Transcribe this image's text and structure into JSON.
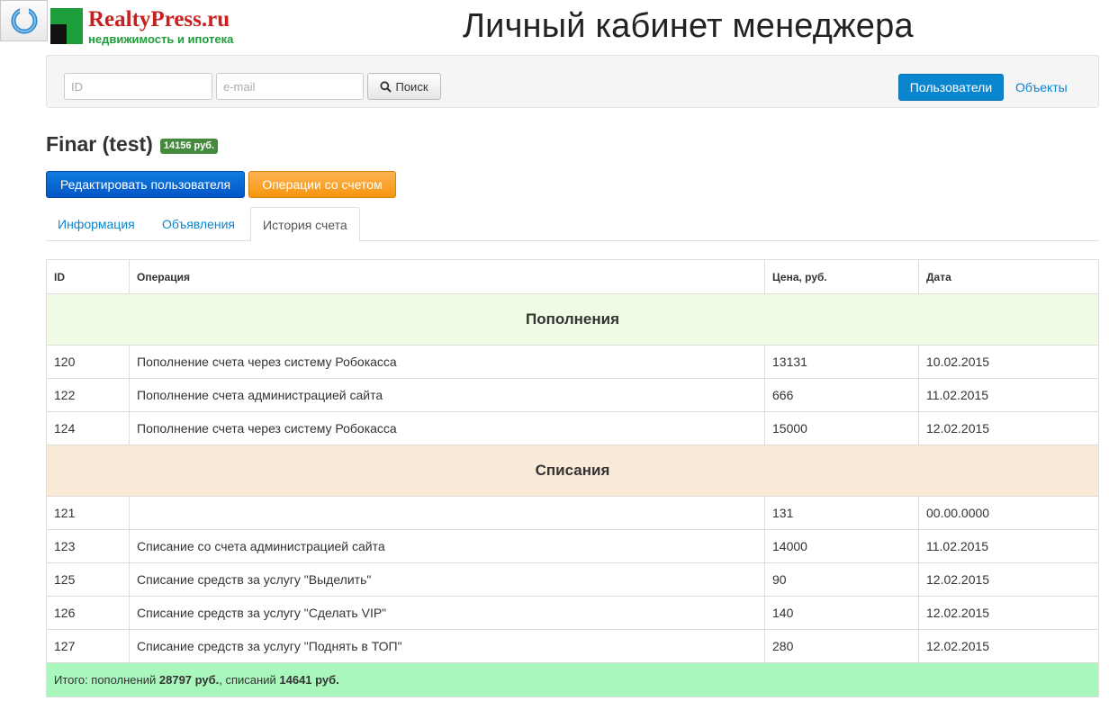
{
  "header": {
    "logo_title": "RealtyPress.ru",
    "logo_subtitle": "недвижимость и ипотека",
    "page_heading": "Личный кабинет менеджера"
  },
  "navbar": {
    "id_placeholder": "ID",
    "email_placeholder": "e-mail",
    "search_label": "Поиск",
    "users_label": "Пользователи",
    "objects_label": "Объекты"
  },
  "user": {
    "name": "Finar (test)",
    "balance": "14156 руб."
  },
  "actions": {
    "edit_user": "Редактировать пользователя",
    "account_ops": "Операции со счетом"
  },
  "tabs": [
    {
      "label": "Информация"
    },
    {
      "label": "Объявления"
    },
    {
      "label": "История счета"
    }
  ],
  "table": {
    "headers": {
      "id": "ID",
      "operation": "Операция",
      "price": "Цена, руб.",
      "date": "Дата"
    },
    "topups_title": "Пополнения",
    "topups": [
      {
        "id": "120",
        "operation": "Пополнение счета через систему Робокасса",
        "price": "13131",
        "date": "10.02.2015"
      },
      {
        "id": "122",
        "operation": "Пополнение счета администрацией сайта",
        "price": "666",
        "date": "11.02.2015"
      },
      {
        "id": "124",
        "operation": "Пополнение счета через систему Робокасса",
        "price": "15000",
        "date": "12.02.2015"
      }
    ],
    "debits_title": "Списания",
    "debits": [
      {
        "id": "121",
        "operation": "",
        "price": "131",
        "date": "00.00.0000"
      },
      {
        "id": "123",
        "operation": "Списание со счета администрацией сайта",
        "price": "14000",
        "date": "11.02.2015"
      },
      {
        "id": "125",
        "operation": "Списание средств за услугу \"Выделить\"",
        "price": "90",
        "date": "12.02.2015"
      },
      {
        "id": "126",
        "operation": "Списание средств за услугу \"Сделать VIP\"",
        "price": "140",
        "date": "12.02.2015"
      },
      {
        "id": "127",
        "operation": "Списание средств за услугу \"Поднять в ТОП\"",
        "price": "280",
        "date": "12.02.2015"
      }
    ],
    "total": {
      "prefix": "Итого: пополнений",
      "topup_sum": "28797 руб.",
      "middle": ", списаний",
      "debit_sum": "14641 руб."
    }
  },
  "colors": {
    "primary": "#0a86ce",
    "badge": "#45893f",
    "topup_bg": "#effbe5",
    "debit_bg": "#f9ead7",
    "total_bg": "#a9f7bd"
  }
}
